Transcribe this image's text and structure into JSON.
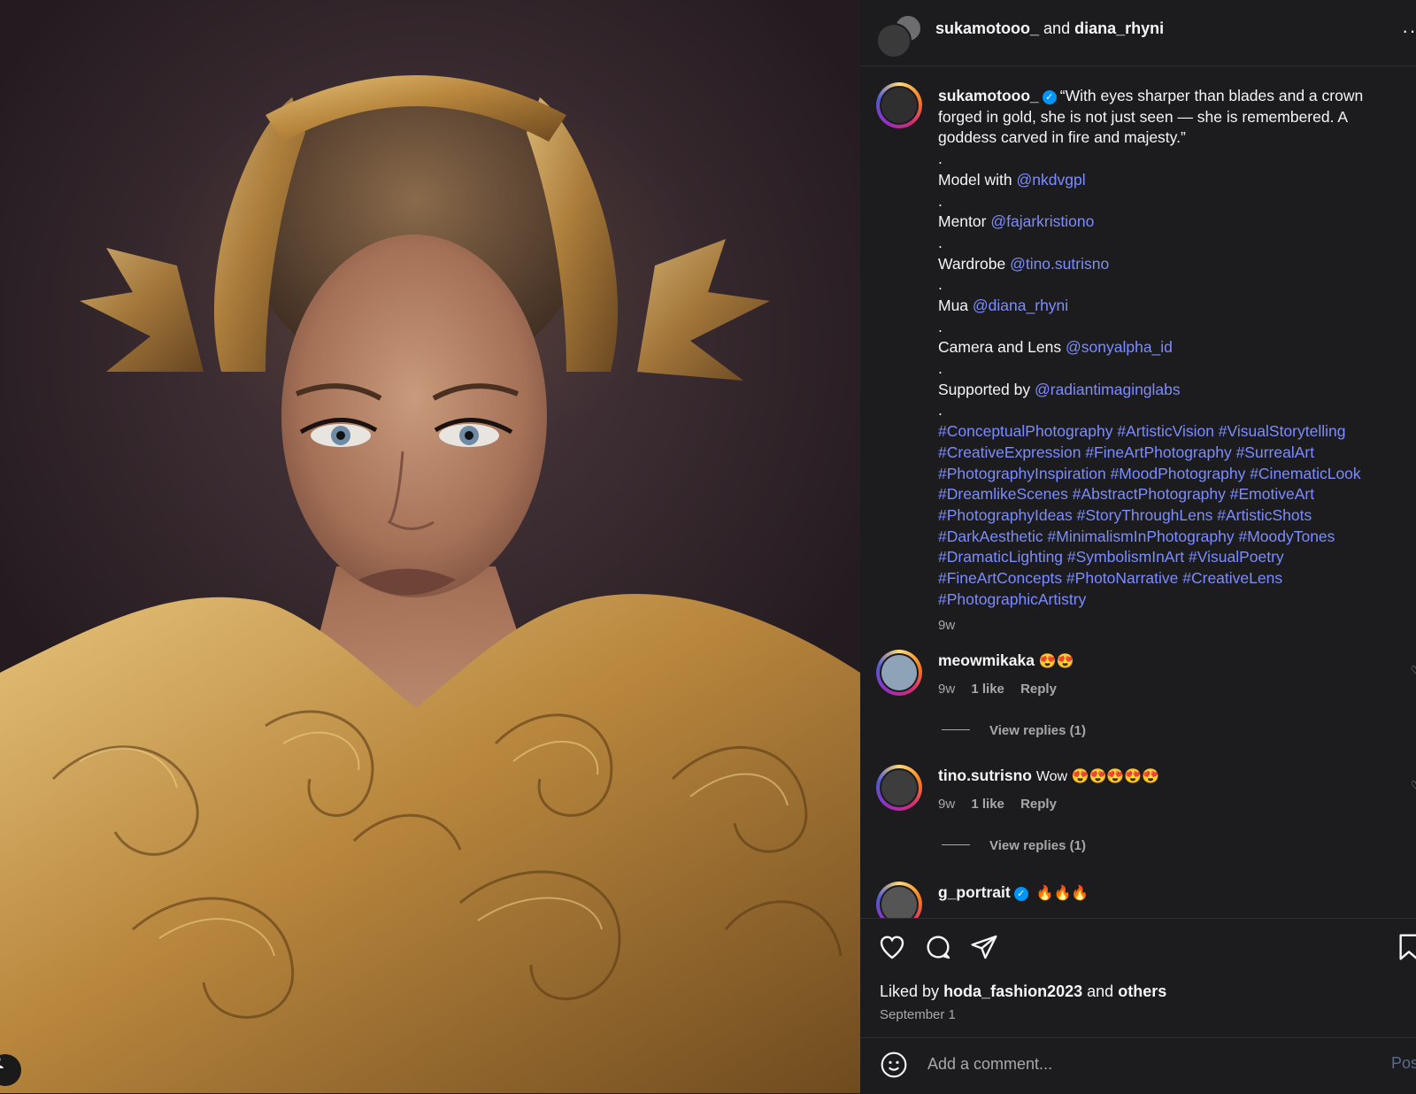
{
  "header": {
    "user1": "sukamotooo_",
    "joiner": "and",
    "user2": "diana_rhyni",
    "more_label": "···"
  },
  "caption": {
    "username": "sukamotooo_",
    "quote": "“With eyes sharper than blades and a crown forged in gold, she is not just seen — she is remembered. A goddess carved in fire and majesty.”",
    "dot": ".",
    "credits": [
      {
        "label": "Model with",
        "handle": "@nkdvgpl"
      },
      {
        "label": "Mentor",
        "handle": "@fajarkristiono"
      },
      {
        "label": "Wardrobe",
        "handle": "@tino.sutrisno"
      },
      {
        "label": "Mua",
        "handle": "@diana_rhyni"
      },
      {
        "label": "Camera and Lens",
        "handle": "@sonyalpha_id"
      },
      {
        "label": "Supported by",
        "handle": "@radiantimaginglabs"
      }
    ],
    "hashtags": [
      "#ConceptualPhotography #ArtisticVision #VisualStorytelling",
      "#CreativeExpression #FineArtPhotography #SurrealArt",
      "#PhotographyInspiration #MoodPhotography #CinematicLook",
      "#DreamlikeScenes #AbstractPhotography #EmotiveArt",
      "#PhotographyIdeas #StoryThroughLens #ArtisticShots",
      "#DarkAesthetic #MinimalismInPhotography #MoodyTones",
      "#DramaticLighting #SymbolismInArt #VisualPoetry",
      "#FineArtConcepts #PhotoNarrative #CreativeLens",
      "#PhotographicArtistry"
    ],
    "time": "9w"
  },
  "comments": [
    {
      "username": "meowmikaka",
      "text": "😍😍",
      "time": "9w",
      "likes": "1 like",
      "reply": "Reply",
      "view_replies": "View replies (1)"
    },
    {
      "username": "tino.sutrisno",
      "text": "Wow 😍😍😍😍😍",
      "time": "9w",
      "likes": "1 like",
      "reply": "Reply",
      "view_replies": "View replies (1)"
    },
    {
      "username": "g_portrait",
      "text": "🔥🔥🔥"
    }
  ],
  "actions": {
    "liked_prefix": "Liked by",
    "liked_user": "hoda_fashion2023",
    "liked_and": "and",
    "liked_others": "others",
    "date": "September 1"
  },
  "comment_box": {
    "placeholder": "Add a comment...",
    "post_label": "Pos"
  }
}
